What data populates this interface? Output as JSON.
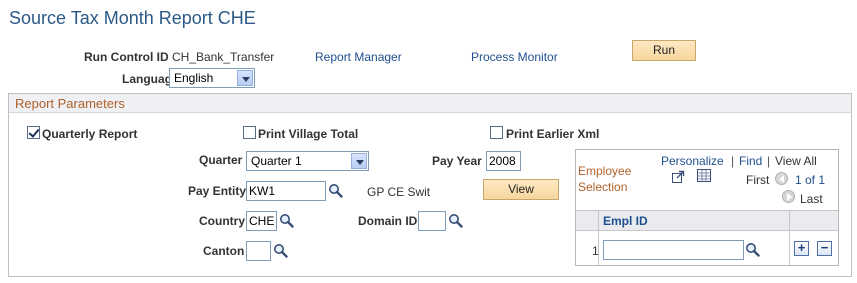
{
  "page": {
    "title": "Source Tax Month Report CHE"
  },
  "run_control": {
    "label": "Run Control ID",
    "value": "CH_Bank_Transfer",
    "report_manager": "Report Manager",
    "process_monitor": "Process Monitor",
    "run_button": "Run",
    "language_label": "Language",
    "language_value": "English"
  },
  "report_parameters": {
    "title": "Report Parameters",
    "quarterly_report": {
      "label": "Quarterly Report",
      "checked": true
    },
    "print_village_total": {
      "label": "Print Village Total",
      "checked": false
    },
    "print_earlier_xml": {
      "label": "Print Earlier Xml",
      "checked": false
    },
    "quarter_label": "Quarter",
    "quarter_value": "Quarter 1",
    "pay_year_label": "Pay Year",
    "pay_year_value": "2008",
    "pay_entity_label": "Pay Entity",
    "pay_entity_value": "KW1",
    "pay_entity_desc": "GP CE Swit",
    "view_button": "View",
    "country_label": "Country",
    "country_value": "CHE",
    "domain_id_label": "Domain ID",
    "domain_id_value": "",
    "canton_label": "Canton",
    "canton_value": ""
  },
  "employee_grid": {
    "title_line1": "Employee",
    "title_line2": "Selection",
    "personalize": "Personalize",
    "separator": "|",
    "find": "Find",
    "view_all": "View All",
    "first": "First",
    "range": "1 of 1",
    "last": "Last",
    "column_header": "Empl ID",
    "rows": [
      {
        "num": "1",
        "empl_id": ""
      }
    ],
    "add": "+",
    "remove": "−"
  },
  "icons": {
    "lookup": "magnifier-icon",
    "zoom": "new-window-icon",
    "download": "spreadsheet-icon"
  },
  "colors": {
    "title": "#2c5987",
    "section_title": "#b0612a",
    "link": "#1f4f8f",
    "button_bg": "#f7d59d"
  }
}
